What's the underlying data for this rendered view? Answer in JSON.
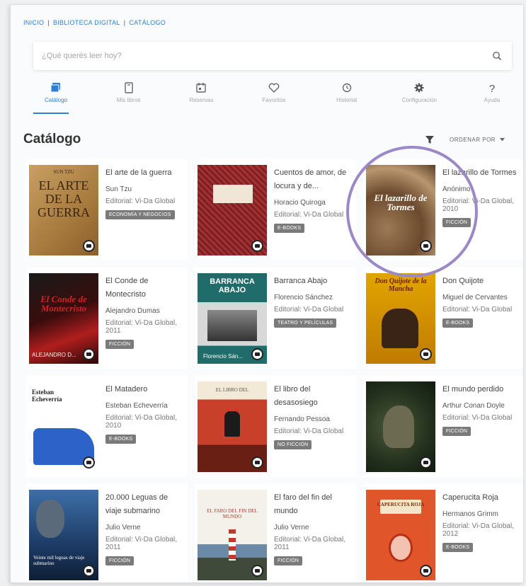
{
  "breadcrumb": [
    "INICIO",
    "BIBLIOTECA DIGITAL",
    "CATÁLOGO"
  ],
  "search": {
    "placeholder": "¿Qué querés leer hoy?"
  },
  "nav": [
    {
      "label": "Catálogo",
      "icon": "catalog-icon",
      "active": true
    },
    {
      "label": "Mis libros",
      "icon": "my-books-icon"
    },
    {
      "label": "Reservas",
      "icon": "reservations-icon"
    },
    {
      "label": "Favoritos",
      "icon": "heart-icon"
    },
    {
      "label": "Historial",
      "icon": "history-icon"
    },
    {
      "label": "Configuración",
      "icon": "gear-icon"
    },
    {
      "label": "Ayuda",
      "icon": "help-icon"
    }
  ],
  "page_title": "Catálogo",
  "sort_label": "ORDENAR POR",
  "colors": {
    "accent": "#2f7fcf",
    "highlight": "#9b88c6",
    "tag": "#7a7a7a"
  },
  "books": [
    {
      "title": "El arte de la guerra",
      "author": "Sun Tzu",
      "editorial": "Editorial: Vi-Da Global",
      "tag": "ECONOMÍA Y NEGOCIOS",
      "cover_text": "EL ARTE DE LA GUERRA",
      "cover_top": "SUN TZU"
    },
    {
      "title": "Cuentos de amor, de locura y de...",
      "author": "Horacio Quiroga",
      "editorial": "Editorial: Vi-Da Global",
      "tag": "E-BOOKS"
    },
    {
      "title": "El lazarillo de Tormes",
      "author": "Anónimo",
      "editorial": "Editorial: Vi-Da Global, 2010",
      "tag": "FICCIÓN",
      "cover_text": "El lazarillo de Tormes"
    },
    {
      "title": "El Conde de Montecristo",
      "author": "Alejandro Dumas",
      "editorial": "Editorial: Vi-Da Global, 2011",
      "tag": "FICCIÓN",
      "cover_text": "El Conde de Montecristo",
      "cover_author": "ALEJANDRO D..."
    },
    {
      "title": "Barranca Abajo",
      "author": "Florencio Sánchez",
      "editorial": "Editorial: Vi-Da Global",
      "tag": "TEATRO Y PELÍCULAS",
      "cover_text": "BARRANCA ABAJO",
      "cover_author": "Florencio Sán..."
    },
    {
      "title": "Don Quijote",
      "author": "Miguel de Cervantes",
      "editorial": "Editorial: Vi-Da Global",
      "tag": "E-BOOKS",
      "cover_text": "Don Quijote de la Mancha"
    },
    {
      "title": "El Matadero",
      "author": "Esteban Echeverría",
      "editorial": "Editorial: Vi-Da Global, 2010",
      "tag": "E-BOOKS",
      "cover_text": "Esteban Echeverría"
    },
    {
      "title": "El libro del desasosiego",
      "author": "Fernando Pessoa",
      "editorial": "Editorial: Vi-Da Global",
      "tag": "NO FICCIÓN",
      "cover_text": "EL LIBRO DEL"
    },
    {
      "title": "El mundo perdido",
      "author": "Arthur Conan Doyle",
      "editorial": "Editorial: Vi-Da Global",
      "tag": "FICCIÓN"
    },
    {
      "title": "20.000 Leguas de viaje submarino",
      "author": "Julio Verne",
      "editorial": "Editorial: Vi-Da Global, 2011",
      "tag": "FICCIÓN",
      "cover_text": "Veinte mil leguas de viaje submarino"
    },
    {
      "title": "El faro del fin del mundo",
      "author": "Julio Verne",
      "editorial": "Editorial: Vi-Da Global, 2011",
      "tag": "FICCIÓN",
      "cover_text": "EL FARO DEL FIN DEL MUNDO"
    },
    {
      "title": "Caperucita Roja",
      "author": "Hermanos Grimm",
      "editorial": "Editorial: Vi-Da Global, 2012",
      "tag": "E-BOOKS",
      "cover_text": "CAPERUCITA ROJA"
    }
  ]
}
